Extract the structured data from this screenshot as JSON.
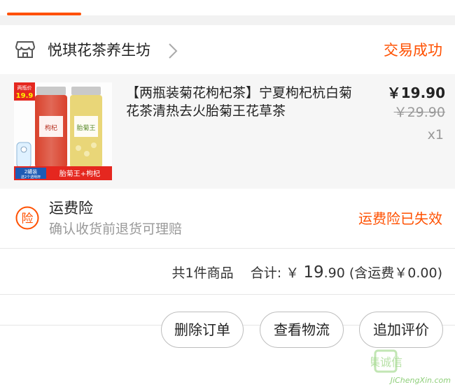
{
  "colors": {
    "accent": "#ff5000",
    "muted": "#999999",
    "text": "#222222"
  },
  "shop": {
    "icon": "store-icon",
    "name": "悦琪花茶养生坊",
    "chevron": "chevron-right-icon",
    "status": "交易成功"
  },
  "item": {
    "title": "【两瓶装菊花枸杞茶】宁夏枸杞杭白菊花茶清热去火胎菊王花草茶",
    "price_now": "￥19.90",
    "price_old": "￥29.90",
    "qty": "x1",
    "thumb": {
      "promo": "两瓶价",
      "promo_price": "19.9",
      "jar_left_label": "枸杞",
      "jar_right_label": "胎菊王",
      "bottom_left": "2罐装",
      "bottom_sub": "送2个透明杯",
      "bottom_right": "胎菊王+枸杞"
    }
  },
  "insurance": {
    "icon_char": "险",
    "title": "运费险",
    "subtitle": "确认收货前退货可理赔",
    "status": "运费险已失效"
  },
  "summary": {
    "count": "共1件商品",
    "total_label": "合计: ",
    "currency": "￥",
    "total_int": "19",
    "total_dec": ".90",
    "shipping": " (含运费￥0.00)"
  },
  "actions": {
    "delete": "删除订单",
    "logistics": "查看物流",
    "review": "追加评价"
  },
  "watermark": {
    "text": "JiChengXin.com",
    "mark": "集诚信"
  }
}
